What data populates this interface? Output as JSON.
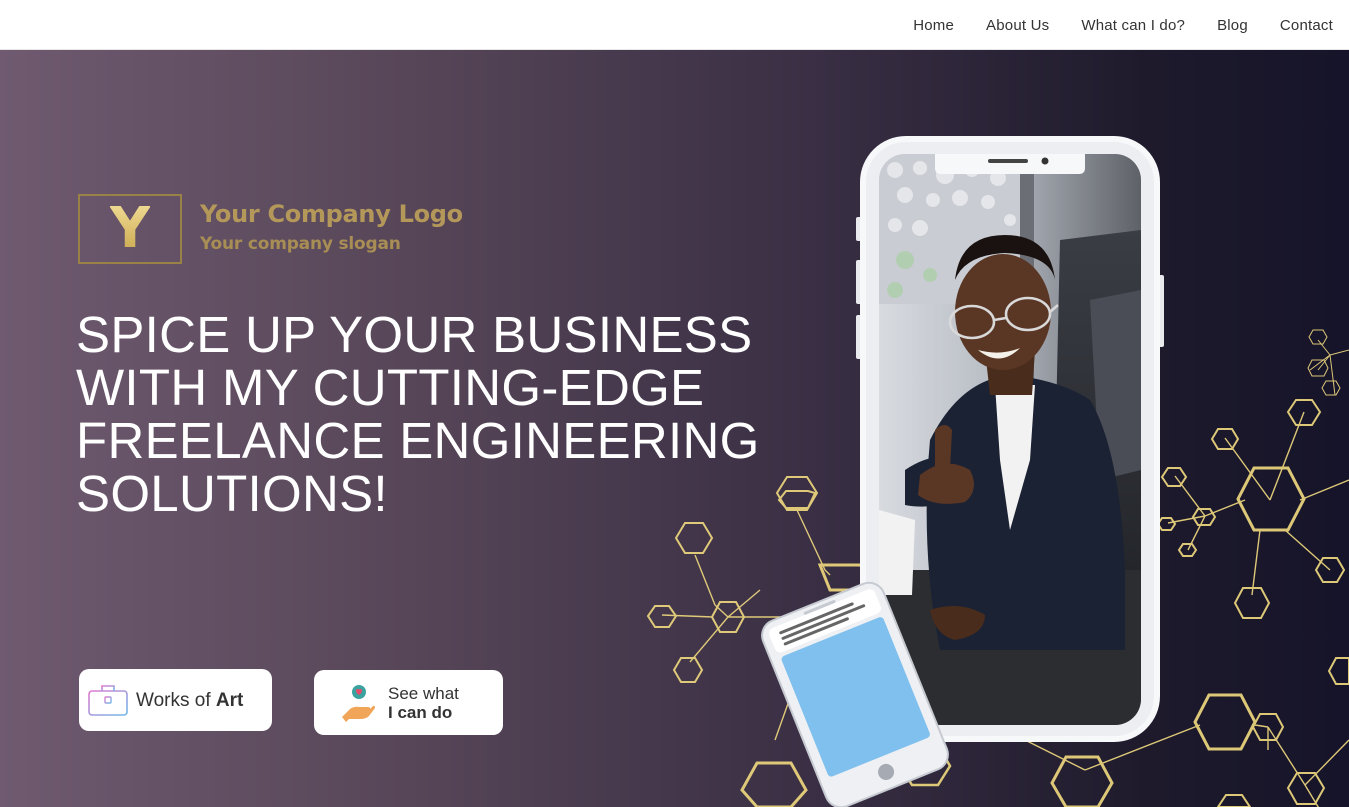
{
  "nav": {
    "items": [
      {
        "label": "Home"
      },
      {
        "label": "About Us"
      },
      {
        "label": "What can I do?"
      },
      {
        "label": "Blog"
      },
      {
        "label": "Contact"
      }
    ]
  },
  "logo": {
    "letter": "Y",
    "name": "Your Company Logo",
    "slogan": "Your company slogan"
  },
  "hero": {
    "headline_lines": [
      "SPICE UP YOUR BUSINESS",
      "WITH MY CUTTING-EDGE",
      "FREELANCE ENGINEERING",
      "SOLUTIONS!"
    ]
  },
  "buttons": {
    "works": {
      "prefix": "Works of ",
      "bold": "Art",
      "icon": "briefcase-icon"
    },
    "see": {
      "line1": "See what",
      "line2": "I can do",
      "icon": "hand-heart-icon"
    }
  },
  "colors": {
    "gradient_start": "#6f5a70",
    "gradient_end": "#16142a",
    "logo_gold": "#b4985a",
    "hex_lines": "#e8d27c"
  }
}
